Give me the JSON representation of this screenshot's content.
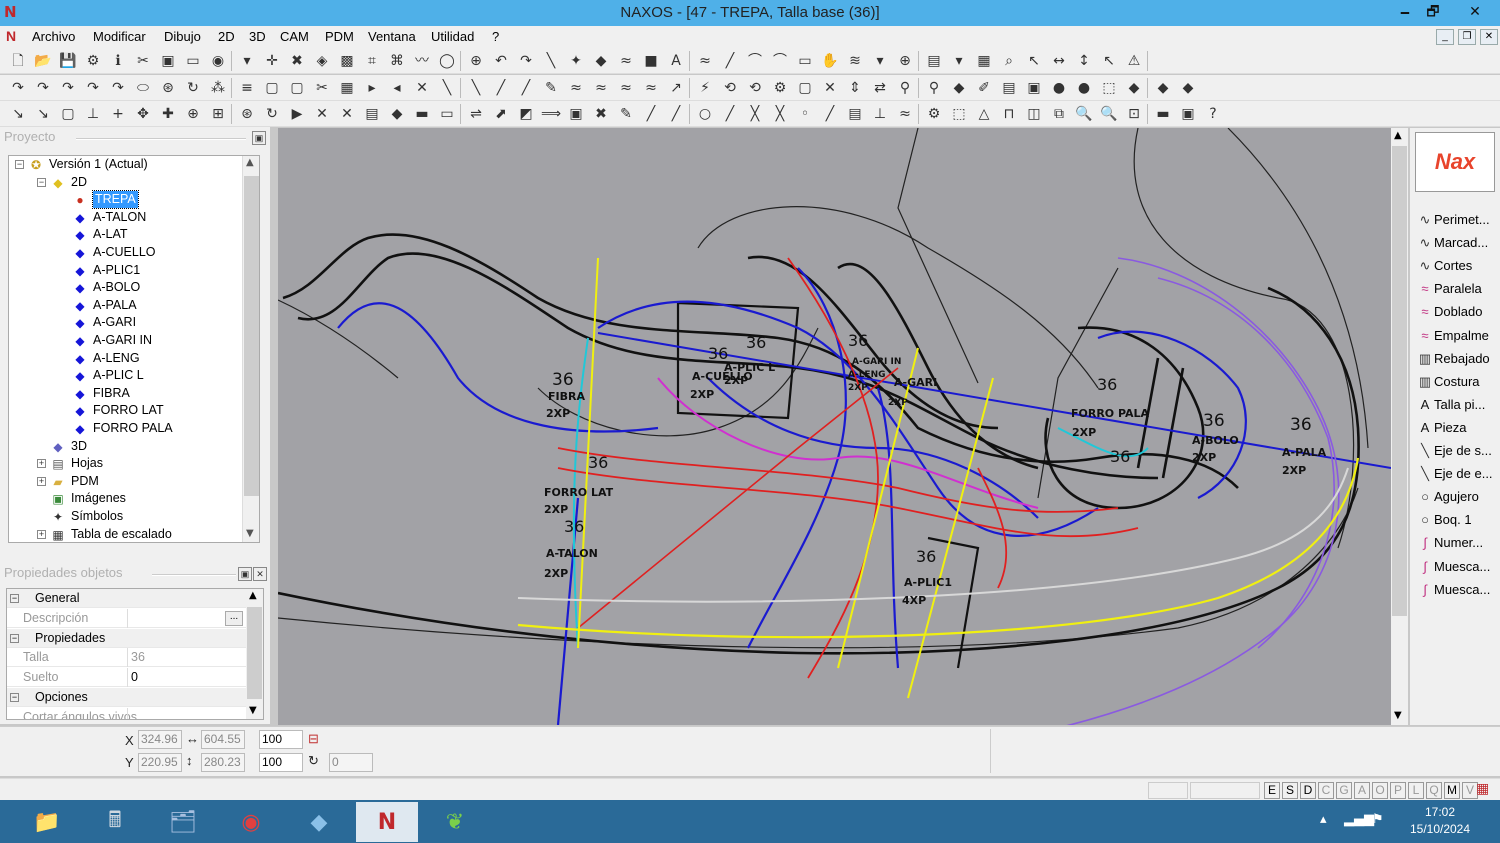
{
  "window": {
    "title": "NAXOS - [47 - TREPA, Talla base (36)]",
    "controls": [
      "🗕",
      "🗗",
      "✕"
    ]
  },
  "menu": [
    "Archivo",
    "Modificar",
    "Dibujo",
    "2D",
    "3D",
    "CAM",
    "PDM",
    "Ventana",
    "Utilidad",
    "?"
  ],
  "proyecto": {
    "header": "Proyecto",
    "tree": [
      {
        "label": "Versión 1 (Actual)",
        "level": 0,
        "expander": "−",
        "icon": "version-icon"
      },
      {
        "label": "2D",
        "level": 1,
        "expander": "−",
        "icon": "2d-icon"
      },
      {
        "label": "TREPA",
        "level": 2,
        "icon": "red-dot-icon",
        "selected": true
      },
      {
        "label": "A-TALON",
        "level": 2,
        "icon": "diamond-icon"
      },
      {
        "label": "A-LAT",
        "level": 2,
        "icon": "diamond-icon"
      },
      {
        "label": "A-CUELLO",
        "level": 2,
        "icon": "diamond-icon"
      },
      {
        "label": "A-PLIC1",
        "level": 2,
        "icon": "diamond-icon"
      },
      {
        "label": "A-BOLO",
        "level": 2,
        "icon": "diamond-icon"
      },
      {
        "label": "A-PALA",
        "level": 2,
        "icon": "diamond-icon"
      },
      {
        "label": "A-GARI",
        "level": 2,
        "icon": "diamond-icon"
      },
      {
        "label": "A-GARI IN",
        "level": 2,
        "icon": "diamond-icon"
      },
      {
        "label": "A-LENG",
        "level": 2,
        "icon": "diamond-icon"
      },
      {
        "label": "A-PLIC L",
        "level": 2,
        "icon": "diamond-icon"
      },
      {
        "label": "FIBRA",
        "level": 2,
        "icon": "diamond-icon"
      },
      {
        "label": "FORRO LAT",
        "level": 2,
        "icon": "diamond-icon"
      },
      {
        "label": "FORRO PALA",
        "level": 2,
        "icon": "diamond-icon"
      },
      {
        "label": "3D",
        "level": 1,
        "icon": "3d-icon"
      },
      {
        "label": "Hojas",
        "level": 1,
        "expander": "+",
        "icon": "sheets-icon"
      },
      {
        "label": "PDM",
        "level": 1,
        "expander": "+",
        "icon": "folder-icon"
      },
      {
        "label": "Imágenes",
        "level": 1,
        "icon": "images-icon"
      },
      {
        "label": "Símbolos",
        "level": 1,
        "icon": "symbols-icon"
      },
      {
        "label": "Tabla de escalado",
        "level": 1,
        "expander": "+",
        "icon": "table-icon"
      }
    ]
  },
  "propiedades": {
    "header": "Propiedades objetos",
    "rows": [
      {
        "type": "group",
        "label": "General"
      },
      {
        "type": "prop",
        "key": "Descripción",
        "value": "",
        "button": "..."
      },
      {
        "type": "group",
        "label": "Propiedades"
      },
      {
        "type": "prop",
        "key": "Talla",
        "value": "36"
      },
      {
        "type": "prop",
        "key": "Suelto",
        "value": "0"
      },
      {
        "type": "group",
        "label": "Opciones"
      },
      {
        "type": "prop",
        "key": "Cortar ángulos vivos",
        "value": ""
      }
    ]
  },
  "drawing_labels": [
    {
      "text": "36"
    },
    {
      "text": "FIBRA"
    },
    {
      "text": "2XP"
    },
    {
      "text": "36"
    },
    {
      "text": "A-CUELLO"
    },
    {
      "text": "2XP"
    },
    {
      "text": "36"
    },
    {
      "text": "A-PLIC L"
    },
    {
      "text": "2XP"
    },
    {
      "text": "36"
    },
    {
      "text": "A-GARI IN"
    },
    {
      "text": "A-LENG"
    },
    {
      "text": "2XP"
    },
    {
      "text": "A-GARI"
    },
    {
      "text": "2XP"
    },
    {
      "text": "36"
    },
    {
      "text": "FORRO PALA"
    },
    {
      "text": "2XP"
    },
    {
      "text": "36"
    },
    {
      "text": "A-BOLO"
    },
    {
      "text": "2XP"
    },
    {
      "text": "36"
    },
    {
      "text": "A-PALA"
    },
    {
      "text": "2XP"
    },
    {
      "text": "36"
    },
    {
      "text": "36"
    },
    {
      "text": "FORRO LAT"
    },
    {
      "text": "2XP"
    },
    {
      "text": "36"
    },
    {
      "text": "A-TALON"
    },
    {
      "text": "2XP"
    },
    {
      "text": "36"
    },
    {
      "text": "A-PLIC1"
    },
    {
      "text": "4XP"
    }
  ],
  "right_panel": {
    "logo": "Nax",
    "items": [
      {
        "label": "Perimet...",
        "icon": "curve-icon"
      },
      {
        "label": "Marcad...",
        "icon": "curve-icon"
      },
      {
        "label": "Cortes",
        "icon": "curve-icon"
      },
      {
        "label": "Paralela",
        "icon": "parallel-icon"
      },
      {
        "label": "Doblado",
        "icon": "fold-icon"
      },
      {
        "label": "Empalme",
        "icon": "join-icon"
      },
      {
        "label": "Rebajado",
        "icon": "skive-icon"
      },
      {
        "label": "Costura",
        "icon": "seam-icon"
      },
      {
        "label": "Talla pi...",
        "icon": "text-icon"
      },
      {
        "label": "Pieza",
        "icon": "text-icon"
      },
      {
        "label": "Eje de s...",
        "icon": "axis-icon"
      },
      {
        "label": "Eje de e...",
        "icon": "axis-icon"
      },
      {
        "label": "Agujero",
        "icon": "circle-icon"
      },
      {
        "label": "Boq. 1",
        "icon": "circle-icon"
      },
      {
        "label": "Numer...",
        "icon": "number-icon"
      },
      {
        "label": "Muesca...",
        "icon": "notch-icon"
      },
      {
        "label": "Muesca...",
        "icon": "notch-icon"
      }
    ]
  },
  "coords": {
    "x_label": "X",
    "y_label": "Y",
    "x": "324.96",
    "y": "220.95",
    "width": "604.55",
    "height": "280.23",
    "scale_x": "100",
    "scale_y": "100",
    "angle": "0"
  },
  "status_keys": [
    {
      "k": "E",
      "on": true
    },
    {
      "k": "S",
      "on": true
    },
    {
      "k": "D",
      "on": true
    },
    {
      "k": "C",
      "on": false
    },
    {
      "k": "G",
      "on": false
    },
    {
      "k": "A",
      "on": false
    },
    {
      "k": "O",
      "on": false
    },
    {
      "k": "P",
      "on": false
    },
    {
      "k": "L",
      "on": false
    },
    {
      "k": "Q",
      "on": false
    },
    {
      "k": "M",
      "on": true
    },
    {
      "k": "V",
      "on": false
    }
  ],
  "taskbar": {
    "apps": [
      {
        "name": "file-explorer-icon",
        "glyph": "📁"
      },
      {
        "name": "calculator-icon",
        "glyph": "🖩"
      },
      {
        "name": "app-icon",
        "glyph": "🗂"
      },
      {
        "name": "chrome-icon",
        "glyph": "◉"
      },
      {
        "name": "app2-icon",
        "glyph": "◆"
      },
      {
        "name": "naxos-icon",
        "glyph": "N"
      },
      {
        "name": "app3-icon",
        "glyph": "❦"
      }
    ],
    "time": "17:02",
    "date": "15/10/2024"
  },
  "colors": {
    "title_bar": "#4fb0e8",
    "canvas": "#a2a2a6",
    "taskbar": "#2a6a98",
    "selection": "#3399ff"
  }
}
